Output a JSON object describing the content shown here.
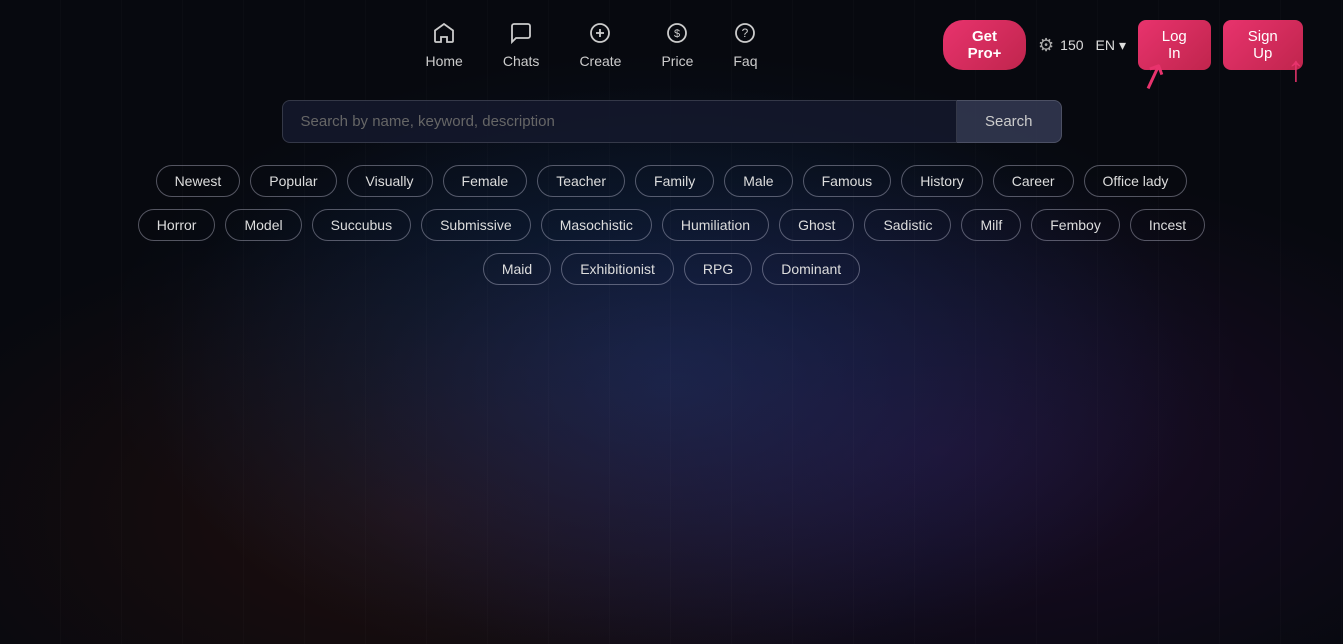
{
  "navbar": {
    "nav_items": [
      {
        "id": "home",
        "label": "Home",
        "icon": "home"
      },
      {
        "id": "chats",
        "label": "Chats",
        "icon": "chat"
      },
      {
        "id": "create",
        "label": "Create",
        "icon": "plus-circle"
      },
      {
        "id": "price",
        "label": "Price",
        "icon": "dollar"
      },
      {
        "id": "faq",
        "label": "Faq",
        "icon": "question"
      }
    ],
    "btn_pro_label": "Get Pro+",
    "credits_value": "150",
    "lang_label": "EN",
    "btn_login_label": "Log In",
    "btn_signup_label": "Sign Up"
  },
  "search": {
    "placeholder": "Search by name, keyword, description",
    "btn_label": "Search"
  },
  "tags": {
    "row1": [
      "Newest",
      "Popular",
      "Visually",
      "Female",
      "Teacher",
      "Family",
      "Male",
      "Famous",
      "History",
      "Career",
      "Office lady"
    ],
    "row2": [
      "Horror",
      "Model",
      "Succubus",
      "Submissive",
      "Masochistic",
      "Humiliation",
      "Ghost",
      "Sadistic",
      "Milf",
      "Femboy",
      "Incest"
    ],
    "row3": [
      "Maid",
      "Exhibitionist",
      "RPG",
      "Dominant"
    ]
  }
}
